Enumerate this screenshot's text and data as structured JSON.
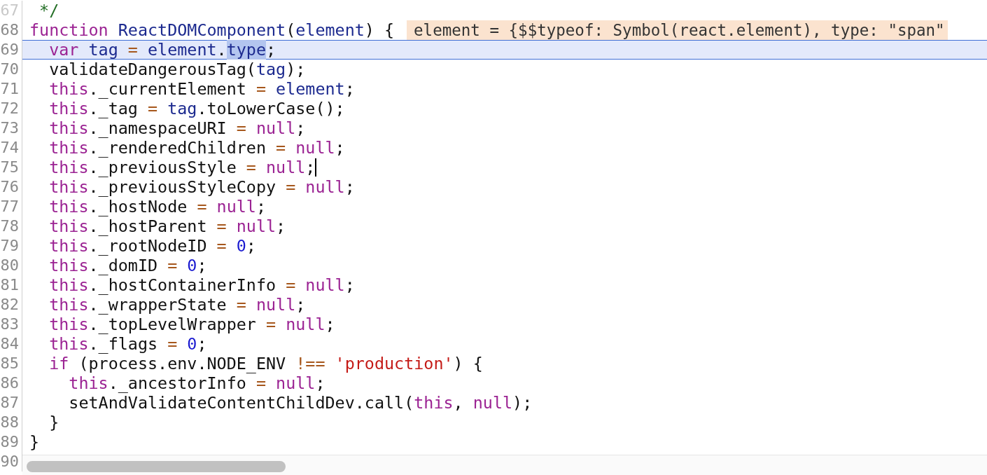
{
  "editor": {
    "lines": [
      {
        "number": "67",
        "current": false,
        "cursor_at_end": false,
        "tokens": [
          {
            "kind": "comment",
            "text": " */"
          }
        ]
      },
      {
        "number": "68",
        "current": false,
        "cursor_at_end": false,
        "tokens": [
          {
            "kind": "keyword",
            "text": "function"
          },
          {
            "kind": "def",
            "text": " ReactDOMComponent"
          },
          {
            "kind": "plain",
            "text": "("
          },
          {
            "kind": "def",
            "text": "element"
          },
          {
            "kind": "plain",
            "text": ") {"
          }
        ],
        "inline_value": "element = {$$typeof: Symbol(react.element), type: \"span\""
      },
      {
        "number": "69",
        "current": true,
        "cursor_at_end": false,
        "tokens": [
          {
            "kind": "keyword",
            "text": "  var"
          },
          {
            "kind": "def",
            "text": " tag"
          },
          {
            "kind": "op",
            "text": " ="
          },
          {
            "kind": "def",
            "text": " element"
          },
          {
            "kind": "plain",
            "text": "."
          },
          {
            "kind": "selected",
            "text": "type"
          },
          {
            "kind": "plain",
            "text": ";"
          }
        ]
      },
      {
        "number": "70",
        "current": false,
        "cursor_at_end": false,
        "tokens": [
          {
            "kind": "plain",
            "text": "  validateDangerousTag("
          },
          {
            "kind": "def",
            "text": "tag"
          },
          {
            "kind": "plain",
            "text": ");"
          }
        ]
      },
      {
        "number": "71",
        "current": false,
        "cursor_at_end": false,
        "tokens": [
          {
            "kind": "keyword",
            "text": "  this"
          },
          {
            "kind": "plain",
            "text": "._currentElement "
          },
          {
            "kind": "op",
            "text": "="
          },
          {
            "kind": "def",
            "text": " element"
          },
          {
            "kind": "plain",
            "text": ";"
          }
        ]
      },
      {
        "number": "72",
        "current": false,
        "cursor_at_end": false,
        "tokens": [
          {
            "kind": "keyword",
            "text": "  this"
          },
          {
            "kind": "plain",
            "text": "._tag "
          },
          {
            "kind": "op",
            "text": "="
          },
          {
            "kind": "def",
            "text": " tag"
          },
          {
            "kind": "plain",
            "text": ".toLowerCase();"
          }
        ]
      },
      {
        "number": "73",
        "current": false,
        "cursor_at_end": false,
        "tokens": [
          {
            "kind": "keyword",
            "text": "  this"
          },
          {
            "kind": "plain",
            "text": "._namespaceURI "
          },
          {
            "kind": "op",
            "text": "="
          },
          {
            "kind": "keyword",
            "text": " null"
          },
          {
            "kind": "plain",
            "text": ";"
          }
        ]
      },
      {
        "number": "74",
        "current": false,
        "cursor_at_end": false,
        "tokens": [
          {
            "kind": "keyword",
            "text": "  this"
          },
          {
            "kind": "plain",
            "text": "._renderedChildren "
          },
          {
            "kind": "op",
            "text": "="
          },
          {
            "kind": "keyword",
            "text": " null"
          },
          {
            "kind": "plain",
            "text": ";"
          }
        ]
      },
      {
        "number": "75",
        "current": false,
        "cursor_at_end": true,
        "tokens": [
          {
            "kind": "keyword",
            "text": "  this"
          },
          {
            "kind": "plain",
            "text": "._previousStyle "
          },
          {
            "kind": "op",
            "text": "="
          },
          {
            "kind": "keyword",
            "text": " null"
          },
          {
            "kind": "plain",
            "text": ";"
          }
        ]
      },
      {
        "number": "76",
        "current": false,
        "cursor_at_end": false,
        "tokens": [
          {
            "kind": "keyword",
            "text": "  this"
          },
          {
            "kind": "plain",
            "text": "._previousStyleCopy "
          },
          {
            "kind": "op",
            "text": "="
          },
          {
            "kind": "keyword",
            "text": " null"
          },
          {
            "kind": "plain",
            "text": ";"
          }
        ]
      },
      {
        "number": "77",
        "current": false,
        "cursor_at_end": false,
        "tokens": [
          {
            "kind": "keyword",
            "text": "  this"
          },
          {
            "kind": "plain",
            "text": "._hostNode "
          },
          {
            "kind": "op",
            "text": "="
          },
          {
            "kind": "keyword",
            "text": " null"
          },
          {
            "kind": "plain",
            "text": ";"
          }
        ]
      },
      {
        "number": "78",
        "current": false,
        "cursor_at_end": false,
        "tokens": [
          {
            "kind": "keyword",
            "text": "  this"
          },
          {
            "kind": "plain",
            "text": "._hostParent "
          },
          {
            "kind": "op",
            "text": "="
          },
          {
            "kind": "keyword",
            "text": " null"
          },
          {
            "kind": "plain",
            "text": ";"
          }
        ]
      },
      {
        "number": "79",
        "current": false,
        "cursor_at_end": false,
        "tokens": [
          {
            "kind": "keyword",
            "text": "  this"
          },
          {
            "kind": "plain",
            "text": "._rootNodeID "
          },
          {
            "kind": "op",
            "text": "="
          },
          {
            "kind": "number",
            "text": " 0"
          },
          {
            "kind": "plain",
            "text": ";"
          }
        ]
      },
      {
        "number": "80",
        "current": false,
        "cursor_at_end": false,
        "tokens": [
          {
            "kind": "keyword",
            "text": "  this"
          },
          {
            "kind": "plain",
            "text": "._domID "
          },
          {
            "kind": "op",
            "text": "="
          },
          {
            "kind": "number",
            "text": " 0"
          },
          {
            "kind": "plain",
            "text": ";"
          }
        ]
      },
      {
        "number": "81",
        "current": false,
        "cursor_at_end": false,
        "tokens": [
          {
            "kind": "keyword",
            "text": "  this"
          },
          {
            "kind": "plain",
            "text": "._hostContainerInfo "
          },
          {
            "kind": "op",
            "text": "="
          },
          {
            "kind": "keyword",
            "text": " null"
          },
          {
            "kind": "plain",
            "text": ";"
          }
        ]
      },
      {
        "number": "82",
        "current": false,
        "cursor_at_end": false,
        "tokens": [
          {
            "kind": "keyword",
            "text": "  this"
          },
          {
            "kind": "plain",
            "text": "._wrapperState "
          },
          {
            "kind": "op",
            "text": "="
          },
          {
            "kind": "keyword",
            "text": " null"
          },
          {
            "kind": "plain",
            "text": ";"
          }
        ]
      },
      {
        "number": "83",
        "current": false,
        "cursor_at_end": false,
        "tokens": [
          {
            "kind": "keyword",
            "text": "  this"
          },
          {
            "kind": "plain",
            "text": "._topLevelWrapper "
          },
          {
            "kind": "op",
            "text": "="
          },
          {
            "kind": "keyword",
            "text": " null"
          },
          {
            "kind": "plain",
            "text": ";"
          }
        ]
      },
      {
        "number": "84",
        "current": false,
        "cursor_at_end": false,
        "tokens": [
          {
            "kind": "keyword",
            "text": "  this"
          },
          {
            "kind": "plain",
            "text": "._flags "
          },
          {
            "kind": "op",
            "text": "="
          },
          {
            "kind": "number",
            "text": " 0"
          },
          {
            "kind": "plain",
            "text": ";"
          }
        ]
      },
      {
        "number": "85",
        "current": false,
        "cursor_at_end": false,
        "tokens": [
          {
            "kind": "keyword",
            "text": "  if"
          },
          {
            "kind": "plain",
            "text": " (process.env.NODE_ENV "
          },
          {
            "kind": "op",
            "text": "!=="
          },
          {
            "kind": "string",
            "text": " 'production'"
          },
          {
            "kind": "plain",
            "text": ") {"
          }
        ]
      },
      {
        "number": "86",
        "current": false,
        "cursor_at_end": false,
        "tokens": [
          {
            "kind": "keyword",
            "text": "    this"
          },
          {
            "kind": "plain",
            "text": "._ancestorInfo "
          },
          {
            "kind": "op",
            "text": "="
          },
          {
            "kind": "keyword",
            "text": " null"
          },
          {
            "kind": "plain",
            "text": ";"
          }
        ]
      },
      {
        "number": "87",
        "current": false,
        "cursor_at_end": false,
        "tokens": [
          {
            "kind": "plain",
            "text": "    setAndValidateContentChildDev.call("
          },
          {
            "kind": "keyword",
            "text": "this"
          },
          {
            "kind": "plain",
            "text": ", "
          },
          {
            "kind": "keyword",
            "text": "null"
          },
          {
            "kind": "plain",
            "text": ");"
          }
        ]
      },
      {
        "number": "88",
        "current": false,
        "cursor_at_end": false,
        "tokens": [
          {
            "kind": "plain",
            "text": "  }"
          }
        ]
      },
      {
        "number": "89",
        "current": false,
        "cursor_at_end": false,
        "tokens": [
          {
            "kind": "plain",
            "text": "}"
          }
        ]
      },
      {
        "number": "90",
        "current": false,
        "cursor_at_end": false
      }
    ]
  }
}
